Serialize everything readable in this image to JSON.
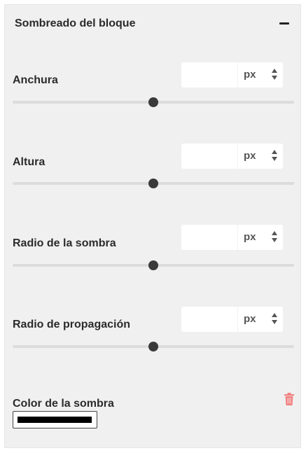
{
  "panel": {
    "title": "Sombreado del bloque",
    "collapse_icon": "minus-icon"
  },
  "controls": [
    {
      "label": "Anchura",
      "value": "",
      "unit": "px",
      "slider_position": 0.5
    },
    {
      "label": "Altura",
      "value": "",
      "unit": "px",
      "slider_position": 0.5
    },
    {
      "label": "Radio de la sombra",
      "value": "",
      "unit": "px",
      "slider_position": 0.5
    },
    {
      "label": "Radio de propagación",
      "value": "",
      "unit": "px",
      "slider_position": 0.5
    }
  ],
  "shadow_color": {
    "label": "Color de la sombra",
    "value": "#000000",
    "delete_icon": "trash-icon",
    "delete_icon_color": "#f08080"
  }
}
